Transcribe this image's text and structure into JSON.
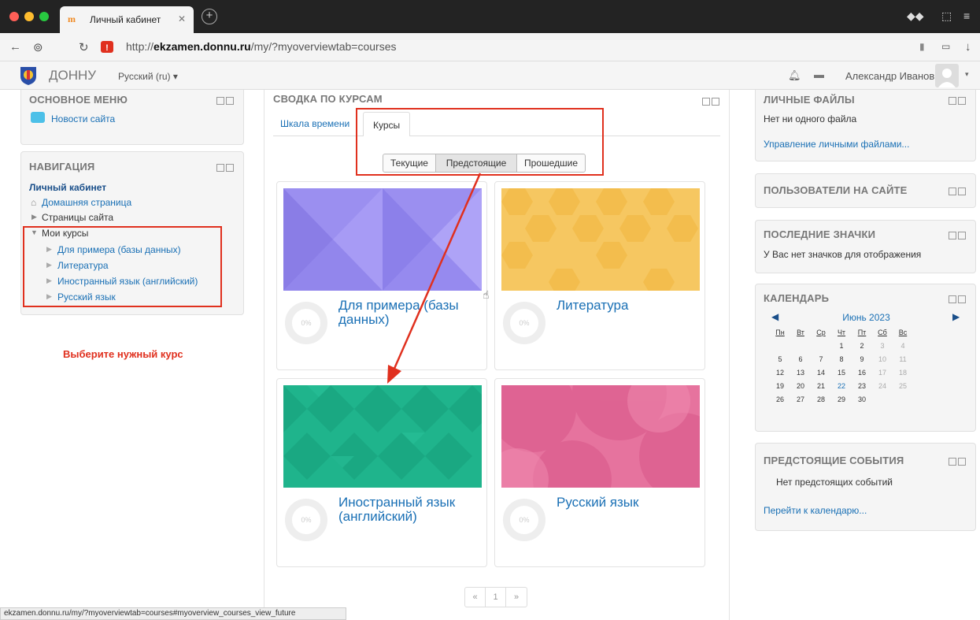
{
  "browser": {
    "tab_title": "Личный кабинет",
    "tab_favicon": "m",
    "url_domain": "ekzamen.donnu.ru",
    "url_prefix": "http://",
    "url_path": "/my/?myoverviewtab=courses"
  },
  "header": {
    "site_name": "ДОННУ",
    "language": "Русский (ru) ▾",
    "user_name": "Александр Иванов"
  },
  "left": {
    "main_menu": {
      "title": "ОСНОВНОЕ МЕНЮ",
      "items": [
        "Новости сайта"
      ]
    },
    "navigation": {
      "title": "НАВИГАЦИЯ",
      "dashboard": "Личный кабинет",
      "home": "Домашняя страница",
      "site_pages": "Страницы сайта",
      "my_courses": "Мои курсы",
      "courses": [
        "Для примера (базы данных)",
        "Литература",
        "Иностранный язык (английский)",
        "Русский язык"
      ]
    },
    "annotation": "Выберите нужный курс"
  },
  "center": {
    "title": "СВОДКА ПО КУРСАМ",
    "tabs": [
      "Шкала времени",
      "Курсы"
    ],
    "filters": [
      "Текущие",
      "Предстоящие",
      "Прошедшие"
    ],
    "courses": [
      {
        "name": "Для примера (базы данных)",
        "progress": "0%",
        "progress_value": 0
      },
      {
        "name": "Литература",
        "progress": "0%",
        "progress_value": 0
      },
      {
        "name": "Иностранный язык (английский)",
        "progress": "0%",
        "progress_value": 0
      },
      {
        "name": "Русский язык",
        "progress": "0%",
        "progress_value": 0
      }
    ],
    "pager": [
      "«",
      "1",
      "»"
    ]
  },
  "right": {
    "private_files": {
      "title": "ЛИЧНЫЕ ФАЙЛЫ",
      "empty": "Нет ни одного файла",
      "manage": "Управление личными файлами..."
    },
    "online_users": {
      "title": "ПОЛЬЗОВАТЕЛИ НА САЙТЕ"
    },
    "badges": {
      "title": "ПОСЛЕДНИЕ ЗНАЧКИ",
      "empty": "У Вас нет значков для отображения"
    },
    "calendar": {
      "title": "КАЛЕНДАРЬ",
      "month": "Июнь 2023",
      "weekdays": [
        "Пн",
        "Вт",
        "Ср",
        "Чт",
        "Пт",
        "Сб",
        "Вс"
      ],
      "weeks": [
        [
          "",
          "",
          "",
          "1",
          "2",
          "3",
          "4"
        ],
        [
          "5",
          "6",
          "7",
          "8",
          "9",
          "10",
          "11"
        ],
        [
          "12",
          "13",
          "14",
          "15",
          "16",
          "17",
          "18"
        ],
        [
          "19",
          "20",
          "21",
          "22",
          "23",
          "24",
          "25"
        ],
        [
          "26",
          "27",
          "28",
          "29",
          "30",
          "",
          ""
        ]
      ],
      "today": "22"
    },
    "events": {
      "title": "ПРЕДСТОЯЩИЕ СОБЫТИЯ",
      "empty": "Нет предстоящих событий",
      "goto": "Перейти к календарю..."
    }
  },
  "status_bar": "ekzamen.donnu.ru/my/?myoverviewtab=courses#myoverview_courses_view_future",
  "colors": {
    "link": "#1a70b5",
    "annotation_red": "#e0301e",
    "card_purple": "#9b8ff0",
    "card_yellow": "#f6c761",
    "card_green": "#1fb48c",
    "card_pink": "#e6739e"
  }
}
